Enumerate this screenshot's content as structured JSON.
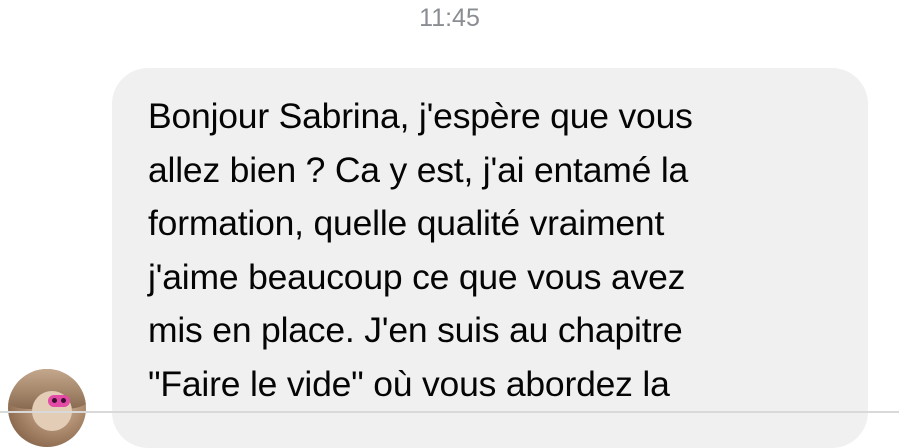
{
  "conversation": {
    "timestamp": "11:45",
    "message": {
      "lines": [
        "Bonjour Sabrina, j'espère que vous",
        "allez bien ? Ca y est, j'ai entamé la",
        "formation, quelle qualité vraiment",
        "j'aime beaucoup ce que vous avez",
        "mis en place. J'en suis au chapitre",
        "\"Faire le vide\" où vous abordez la"
      ]
    },
    "sender_avatar_icon": "avatar",
    "colors": {
      "bubble": "#f1f0f0",
      "text": "#050505",
      "timestamp": "#8a8d91"
    }
  }
}
